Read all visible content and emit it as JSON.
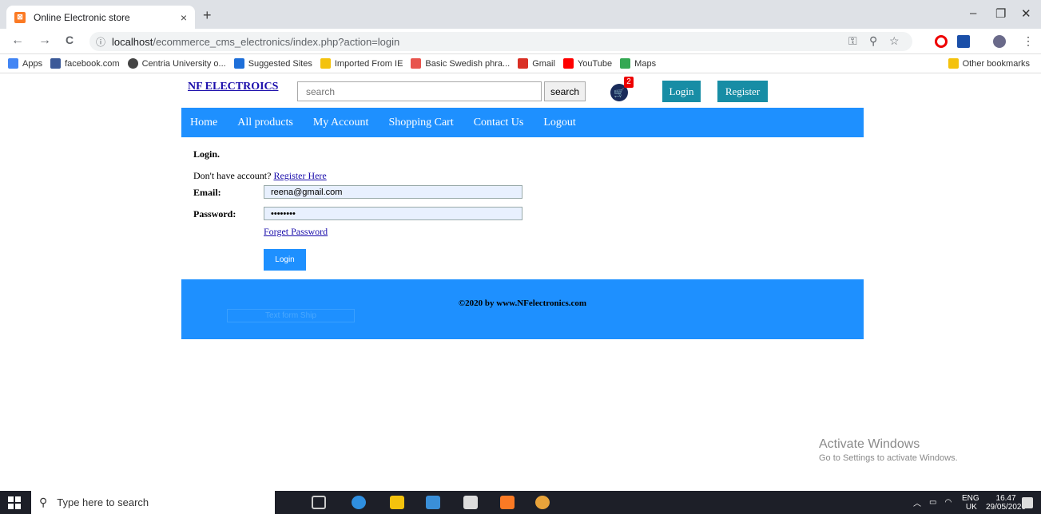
{
  "browser": {
    "tab_title": "Online Electronic store",
    "tab_close": "×",
    "new_tab": "+",
    "window_min": "–",
    "window_max": "❐",
    "window_close": "✕",
    "back": "←",
    "forward": "→",
    "reload": "C",
    "url_info": "ⓘ",
    "url_host": "localhost",
    "url_path": "/ecommerce_cms_electronics/index.php?action=login",
    "menu": "⋮"
  },
  "bookmarks": [
    {
      "label": "Apps",
      "color": "#4285f4"
    },
    {
      "label": "facebook.com",
      "color": "#3b5998"
    },
    {
      "label": "Centria University o...",
      "color": "#444444"
    },
    {
      "label": "Suggested Sites",
      "color": "#1e6fd9"
    },
    {
      "label": "Imported From IE",
      "color": "#f4c20d"
    },
    {
      "label": "Basic Swedish phra...",
      "color": "#e8554e"
    },
    {
      "label": "Gmail",
      "color": "#d93025"
    },
    {
      "label": "YouTube",
      "color": "#ff0000"
    },
    {
      "label": "Maps",
      "color": "#34a853"
    }
  ],
  "other_bookmarks": "Other bookmarks",
  "header": {
    "brand": "NF ELECTROICS",
    "search_placeholder": "search",
    "search_button": "search",
    "cart_count": "2",
    "login": "Login",
    "register": "Register"
  },
  "nav": [
    "Home",
    "All products",
    "My Account",
    "Shopping Cart",
    "Contact Us",
    "Logout"
  ],
  "login": {
    "title": "Login.",
    "no_account": "Don't have account?",
    "register_link": "Register Here",
    "email_label": "Email:",
    "email_value": "reena@gmail.com",
    "password_label": "Password:",
    "password_value": "••••••••",
    "forget": "Forget Password",
    "submit": "Login"
  },
  "footer": {
    "copyright": "©2020 by www.NFelectronics.com",
    "ghost": "Text form Ship"
  },
  "watermark": {
    "line1": "Activate Windows",
    "line2": "Go to Settings to activate Windows."
  },
  "taskbar": {
    "search_placeholder": "Type here to search",
    "lang1": "ENG",
    "lang2": "UK",
    "time": "16.47",
    "date": "29/05/2020"
  }
}
